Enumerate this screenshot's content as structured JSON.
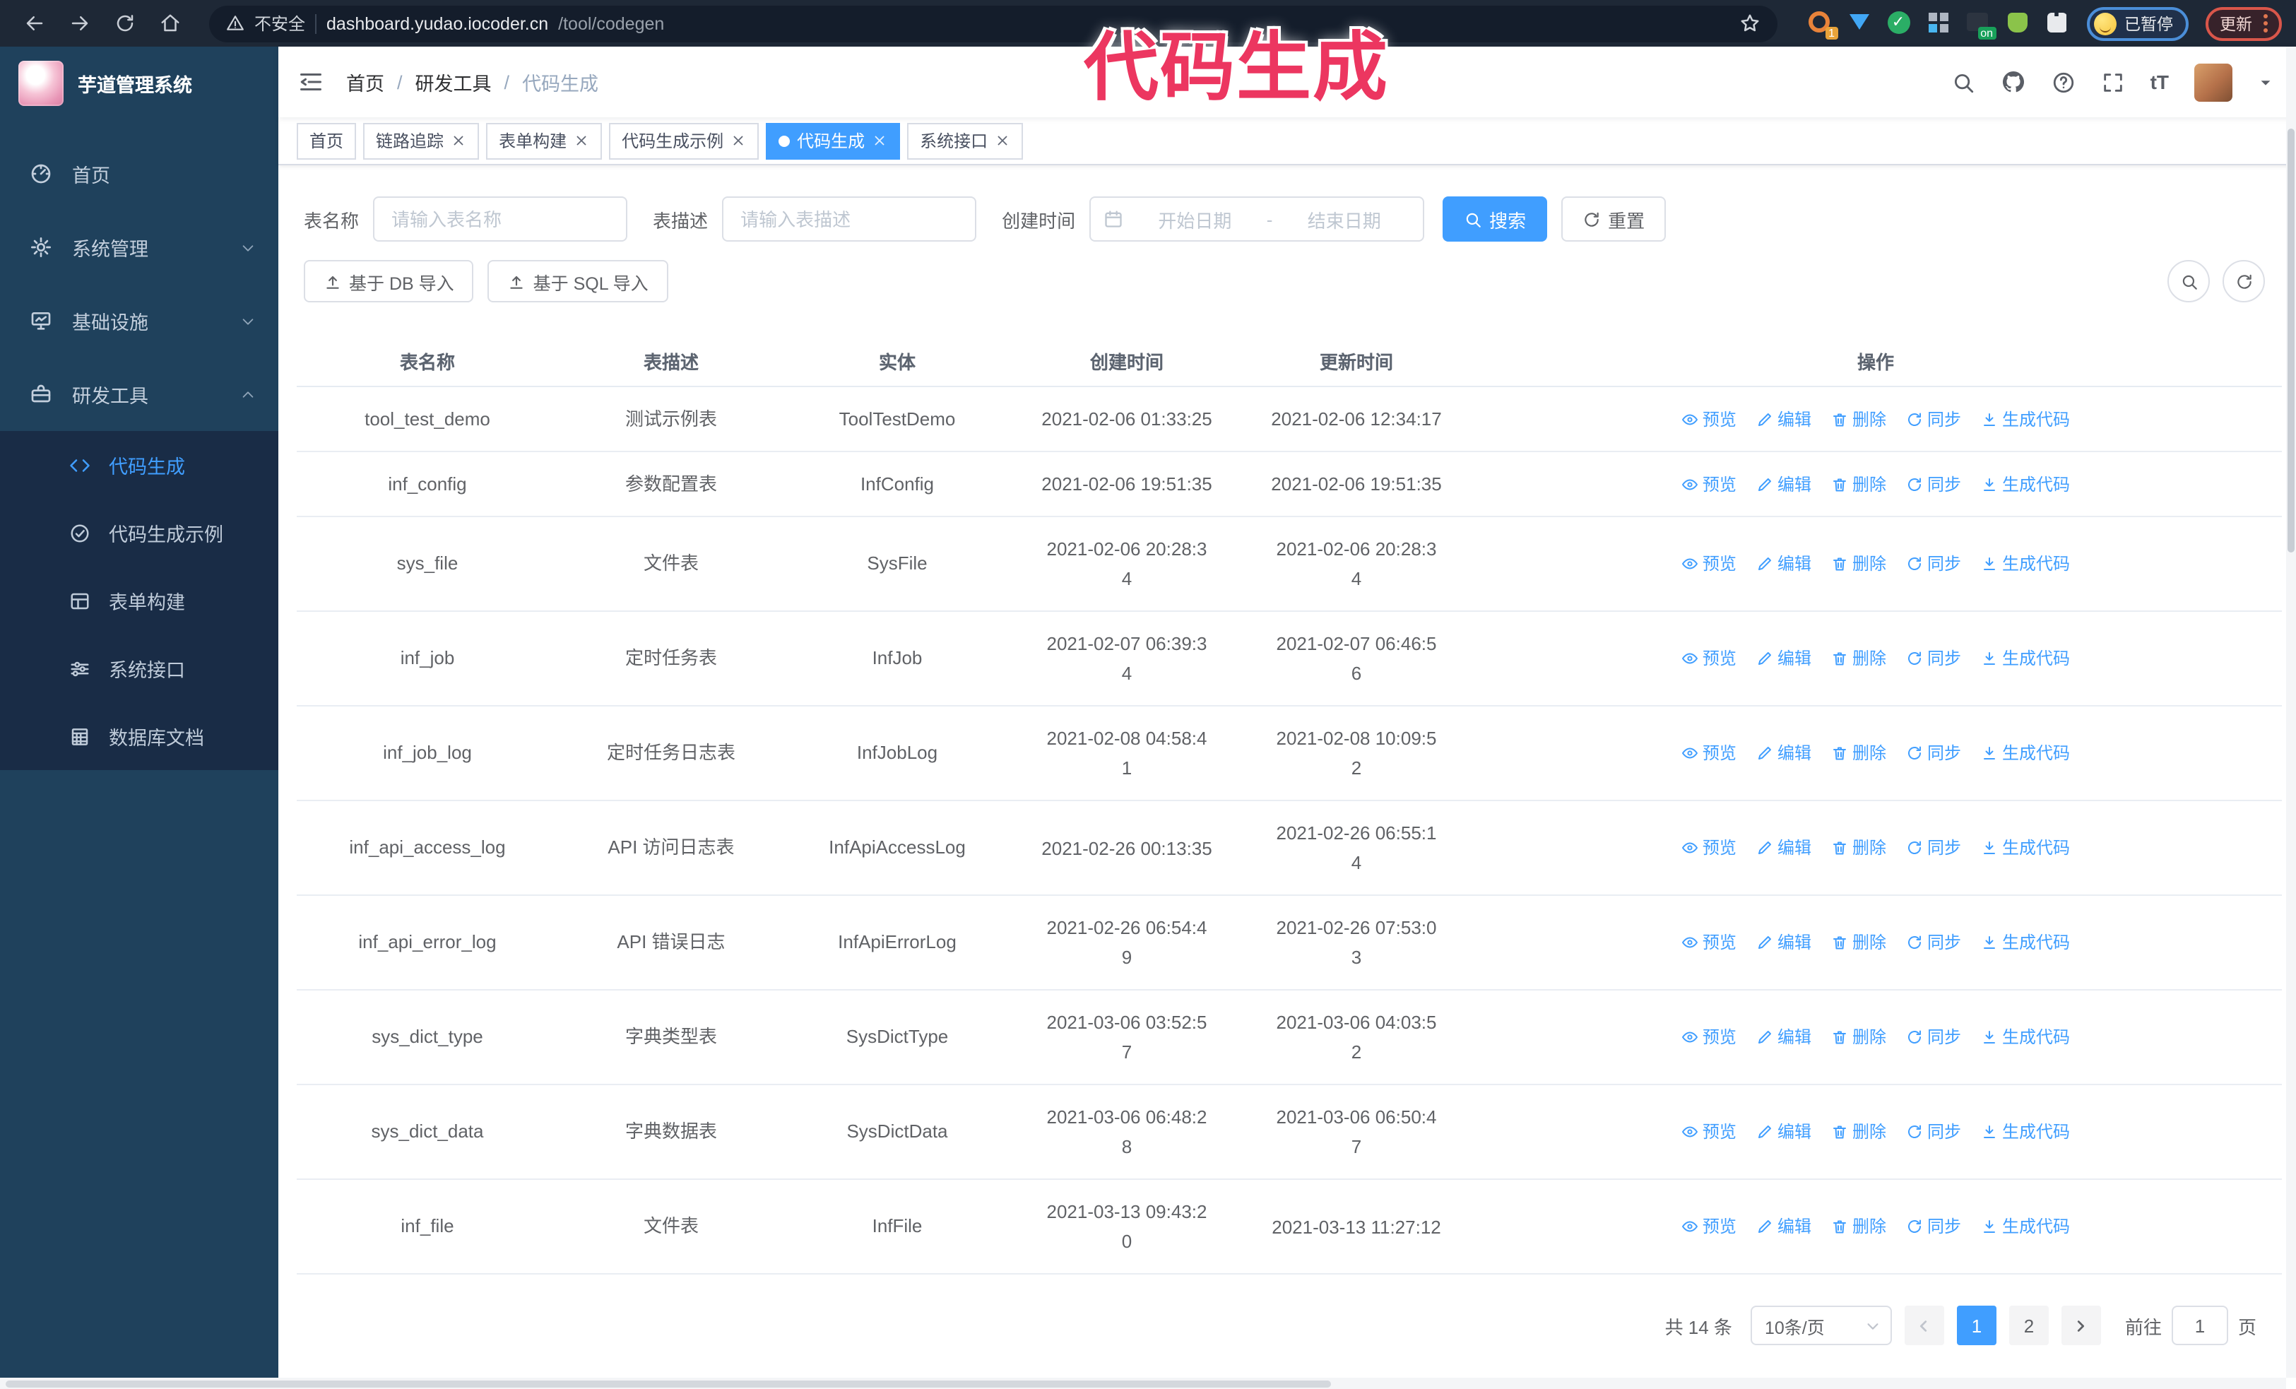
{
  "annotation": {
    "text": "代码生成"
  },
  "browser": {
    "security_label": "不安全",
    "url_host": "dashboard.yudao.iocoder.cn",
    "url_path": "/tool/codegen",
    "extension_badge_count": "1",
    "extension_badge_on": "on",
    "paused_badge": "已暂停",
    "update_button": "更新"
  },
  "sidebar": {
    "app_title": "芋道管理系统",
    "items": [
      {
        "label": "首页",
        "icon": "dashboard-icon"
      },
      {
        "label": "系统管理",
        "icon": "gear-icon"
      },
      {
        "label": "基础设施",
        "icon": "monitor-icon"
      },
      {
        "label": "研发工具",
        "icon": "toolbox-icon"
      }
    ],
    "sub_items": [
      {
        "label": "代码生成",
        "icon": "code-icon",
        "active": true
      },
      {
        "label": "代码生成示例",
        "icon": "badge-check-icon"
      },
      {
        "label": "表单构建",
        "icon": "form-icon"
      },
      {
        "label": "系统接口",
        "icon": "sliders-icon"
      },
      {
        "label": "数据库文档",
        "icon": "database-icon"
      }
    ]
  },
  "header": {
    "breadcrumb": [
      "首页",
      "研发工具",
      "代码生成"
    ],
    "breadcrumb_separator": "/",
    "font_size_icon_text": "tT"
  },
  "tabs": [
    {
      "label": "首页",
      "closable": false,
      "active": false
    },
    {
      "label": "链路追踪",
      "closable": true,
      "active": false
    },
    {
      "label": "表单构建",
      "closable": true,
      "active": false
    },
    {
      "label": "代码生成示例",
      "closable": true,
      "active": false
    },
    {
      "label": "代码生成",
      "closable": true,
      "active": true
    },
    {
      "label": "系统接口",
      "closable": true,
      "active": false
    }
  ],
  "search": {
    "name_label": "表名称",
    "name_placeholder": "请输入表名称",
    "desc_label": "表描述",
    "desc_placeholder": "请输入表描述",
    "date_label": "创建时间",
    "date_start_placeholder": "开始日期",
    "date_separator": "-",
    "date_end_placeholder": "结束日期",
    "search_button": "搜索",
    "reset_button": "重置"
  },
  "toolbar": {
    "import_db_button": "基于 DB 导入",
    "import_sql_button": "基于 SQL 导入"
  },
  "table": {
    "columns": [
      "表名称",
      "表描述",
      "实体",
      "创建时间",
      "更新时间",
      "操作"
    ],
    "actions": [
      "预览",
      "编辑",
      "删除",
      "同步",
      "生成代码"
    ],
    "rows": [
      {
        "name": "tool_test_demo",
        "desc": "测试示例表",
        "entity": "ToolTestDemo",
        "created": [
          "2021-02-06 01:33:25"
        ],
        "updated": [
          "2021-02-06 12:34:17"
        ]
      },
      {
        "name": "inf_config",
        "desc": "参数配置表",
        "entity": "InfConfig",
        "created": [
          "2021-02-06 19:51:35"
        ],
        "updated": [
          "2021-02-06 19:51:35"
        ]
      },
      {
        "name": "sys_file",
        "desc": "文件表",
        "entity": "SysFile",
        "created": [
          "2021-02-06 20:28:3",
          "4"
        ],
        "updated": [
          "2021-02-06 20:28:3",
          "4"
        ]
      },
      {
        "name": "inf_job",
        "desc": "定时任务表",
        "entity": "InfJob",
        "created": [
          "2021-02-07 06:39:3",
          "4"
        ],
        "updated": [
          "2021-02-07 06:46:5",
          "6"
        ]
      },
      {
        "name": "inf_job_log",
        "desc": "定时任务日志表",
        "entity": "InfJobLog",
        "created": [
          "2021-02-08 04:58:4",
          "1"
        ],
        "updated": [
          "2021-02-08 10:09:5",
          "2"
        ]
      },
      {
        "name": "inf_api_access_log",
        "desc": "API 访问日志表",
        "entity": "InfApiAccessLog",
        "created": [
          "2021-02-26 00:13:35"
        ],
        "updated": [
          "2021-02-26 06:55:1",
          "4"
        ]
      },
      {
        "name": "inf_api_error_log",
        "desc": "API 错误日志",
        "entity": "InfApiErrorLog",
        "created": [
          "2021-02-26 06:54:4",
          "9"
        ],
        "updated": [
          "2021-02-26 07:53:0",
          "3"
        ]
      },
      {
        "name": "sys_dict_type",
        "desc": "字典类型表",
        "entity": "SysDictType",
        "created": [
          "2021-03-06 03:52:5",
          "7"
        ],
        "updated": [
          "2021-03-06 04:03:5",
          "2"
        ]
      },
      {
        "name": "sys_dict_data",
        "desc": "字典数据表",
        "entity": "SysDictData",
        "created": [
          "2021-03-06 06:48:2",
          "8"
        ],
        "updated": [
          "2021-03-06 06:50:4",
          "7"
        ]
      },
      {
        "name": "inf_file",
        "desc": "文件表",
        "entity": "InfFile",
        "created": [
          "2021-03-13 09:43:2",
          "0"
        ],
        "updated": [
          "2021-03-13 11:27:12"
        ]
      }
    ]
  },
  "pagination": {
    "total": "共 14 条",
    "page_size": "10条/页",
    "pages": [
      "1",
      "2"
    ],
    "active_page": "1",
    "goto_label": "前往",
    "goto_value": "1",
    "goto_suffix": "页"
  },
  "colors": {
    "accent": "#409eff",
    "sidebar_bg": "#1f415c",
    "submenu_bg": "#192c46",
    "browser_bar_bg": "#1e2836",
    "annotation": "#ec3660"
  }
}
